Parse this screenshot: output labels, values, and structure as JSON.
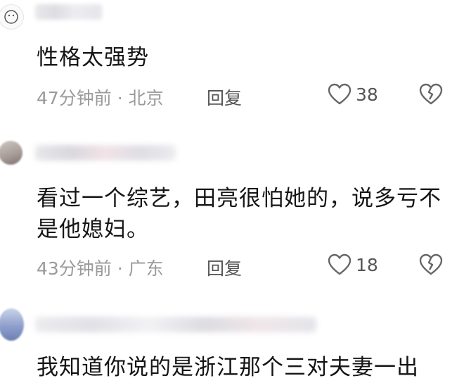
{
  "comments": [
    {
      "text": "性格太强势",
      "time": "47分钟前",
      "separator": "·",
      "location": "北京",
      "reply_label": "回复",
      "likes": "38"
    },
    {
      "text": "看过一个综艺，田亮很怕她的，说多亏不是他媳妇。",
      "time": "43分钟前",
      "separator": "·",
      "location": "广东",
      "reply_label": "回复",
      "likes": "18"
    },
    {
      "text": "我知道你说的是浙江那个三对夫妻一出"
    }
  ],
  "icons": {
    "like": "heart-outline-icon",
    "dislike": "broken-heart-icon"
  },
  "colors": {
    "meta": "#9a9a9a",
    "text": "#151515",
    "icon": "#666666"
  }
}
